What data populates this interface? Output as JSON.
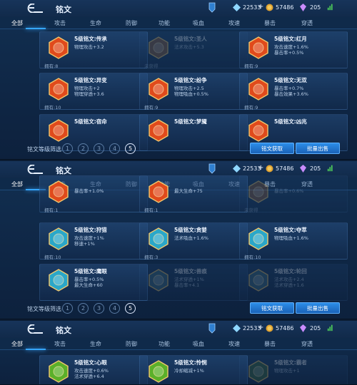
{
  "header": {
    "title": "铭文",
    "res1": "22533",
    "res2": "57486",
    "res3": "205"
  },
  "tabs": [
    "全部",
    "攻击",
    "生命",
    "防御",
    "功能",
    "吸血",
    "攻速",
    "暴击",
    "穿透"
  ],
  "footer": {
    "filter_label": "铭文等级筛选",
    "levels": [
      "1",
      "2",
      "3",
      "4",
      "5"
    ],
    "acquire": "铭文获取",
    "sell": "批量出售"
  },
  "panels": [
    {
      "rows": [
        [
          {
            "name": "5级铭文:传承",
            "stats": [
              "物理攻击+3.2"
            ],
            "owned": "拥有:8",
            "color": "#e04a1c",
            "dim": false
          },
          {
            "name": "5级铭文:圣人",
            "stats": [
              "法术攻击+5.3"
            ],
            "owned": "未获得",
            "color": "#8a5a3a",
            "dim": true
          },
          {
            "name": "5级铭文:红月",
            "stats": [
              "攻击速度+1.6%",
              "暴击率+0.5%"
            ],
            "owned": "拥有:9",
            "color": "#e04a1c",
            "dim": false
          }
        ],
        [
          {
            "name": "5级铭文:异变",
            "stats": [
              "物理攻击+2",
              "物理穿透+3.6"
            ],
            "owned": "拥有:10",
            "color": "#e04a1c",
            "dim": false
          },
          {
            "name": "5级铭文:纷争",
            "stats": [
              "物理攻击+2.5",
              "物理吸血+0.5%"
            ],
            "owned": "拥有:9",
            "color": "#e04a1c",
            "dim": false
          },
          {
            "name": "5级铭文:无双",
            "stats": [
              "暴击率+0.7%",
              "暴击效果+3.6%"
            ],
            "owned": "拥有:9",
            "color": "#e04a1c",
            "dim": false
          }
        ],
        [
          {
            "name": "5级铭文:宿命",
            "stats": [],
            "owned": "",
            "color": "#e04a1c",
            "dim": false
          },
          {
            "name": "5级铭文:梦魇",
            "stats": [],
            "owned": "",
            "color": "#e04a1c",
            "dim": false
          },
          {
            "name": "5级铭文:凶兆",
            "stats": [],
            "owned": "",
            "color": "#e04a1c",
            "dim": false
          }
        ]
      ]
    },
    {
      "rows": [
        [
          {
            "name": "",
            "stats": [
              "暴击率+1.0%"
            ],
            "owned": "拥有:1",
            "color": "#e04a1c",
            "dim": false
          },
          {
            "name": "",
            "stats": [
              "最大生命+75"
            ],
            "owned": "拥有:1",
            "color": "#e04a1c",
            "dim": false
          },
          {
            "name": "",
            "stats": [
              "暴击率+0.6%"
            ],
            "owned": "未获得",
            "color": "#8a5a3a",
            "dim": true
          }
        ],
        [
          {
            "name": "5级铭文:狩猎",
            "stats": [
              "攻击速度+1%",
              "移速+1%"
            ],
            "owned": "拥有:10",
            "color": "#2aa7c9",
            "dim": false
          },
          {
            "name": "5级铭文:贪婪",
            "stats": [
              "法术吸血+1.6%"
            ],
            "owned": "拥有:3",
            "color": "#2aa7c9",
            "dim": false
          },
          {
            "name": "5级铭文:夺萃",
            "stats": [
              "物理吸血+1.6%"
            ],
            "owned": "拥有:10",
            "color": "#2aa7c9",
            "dim": false
          }
        ],
        [
          {
            "name": "5级铭文:鹰眼",
            "stats": [
              "暴击率+0.5%",
              "最大生命+60"
            ],
            "owned": "",
            "color": "#2aa7c9",
            "dim": false
          },
          {
            "name": "5级铭文:兽痕",
            "stats": [
              "法术穿透+1%",
              "暴击率+4.1"
            ],
            "owned": "",
            "color": "#3a6a80",
            "dim": true
          },
          {
            "name": "5级铭文:轮回",
            "stats": [
              "法术攻击+2.4",
              "法术穿透+1.6"
            ],
            "owned": "",
            "color": "#3a6a80",
            "dim": true
          }
        ]
      ]
    },
    {
      "rows": [
        [
          {
            "name": "5级铭文:心眼",
            "stats": [
              "攻击速度+0.6%",
              "法术穿透+6.4"
            ],
            "owned": "",
            "color": "#5ab02a",
            "dim": false
          },
          {
            "name": "5级铭文:怜悯",
            "stats": [
              "冷却缩减+1%"
            ],
            "owned": "",
            "color": "#5ab02a",
            "dim": false
          },
          {
            "name": "5级铭文:霸者",
            "stats": [
              "物理攻击+1"
            ],
            "owned": "",
            "color": "#3a6a40",
            "dim": true
          }
        ]
      ]
    }
  ]
}
